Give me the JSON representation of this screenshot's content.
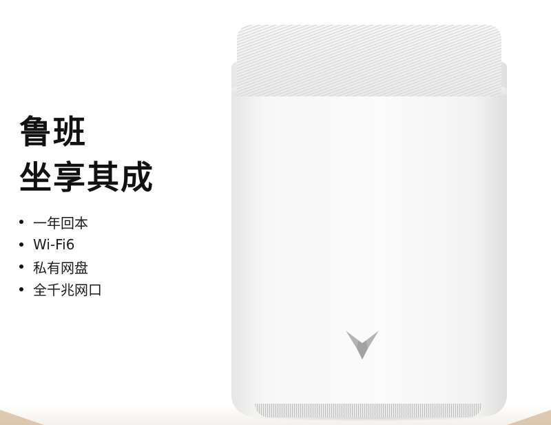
{
  "headline": {
    "line1": "鲁班",
    "line2": "坐享其成"
  },
  "features": [
    "一年回本",
    "Wi-Fi6",
    "私有网盘",
    "全千兆网口"
  ],
  "colors": {
    "text": "#111111",
    "device": "#f7f7f7",
    "logo": "#a9a9a9",
    "accent_floor": "#c9a27b"
  },
  "icons": {
    "logo": "brand-y-logo-icon",
    "bullet": "bullet-dot-icon"
  }
}
